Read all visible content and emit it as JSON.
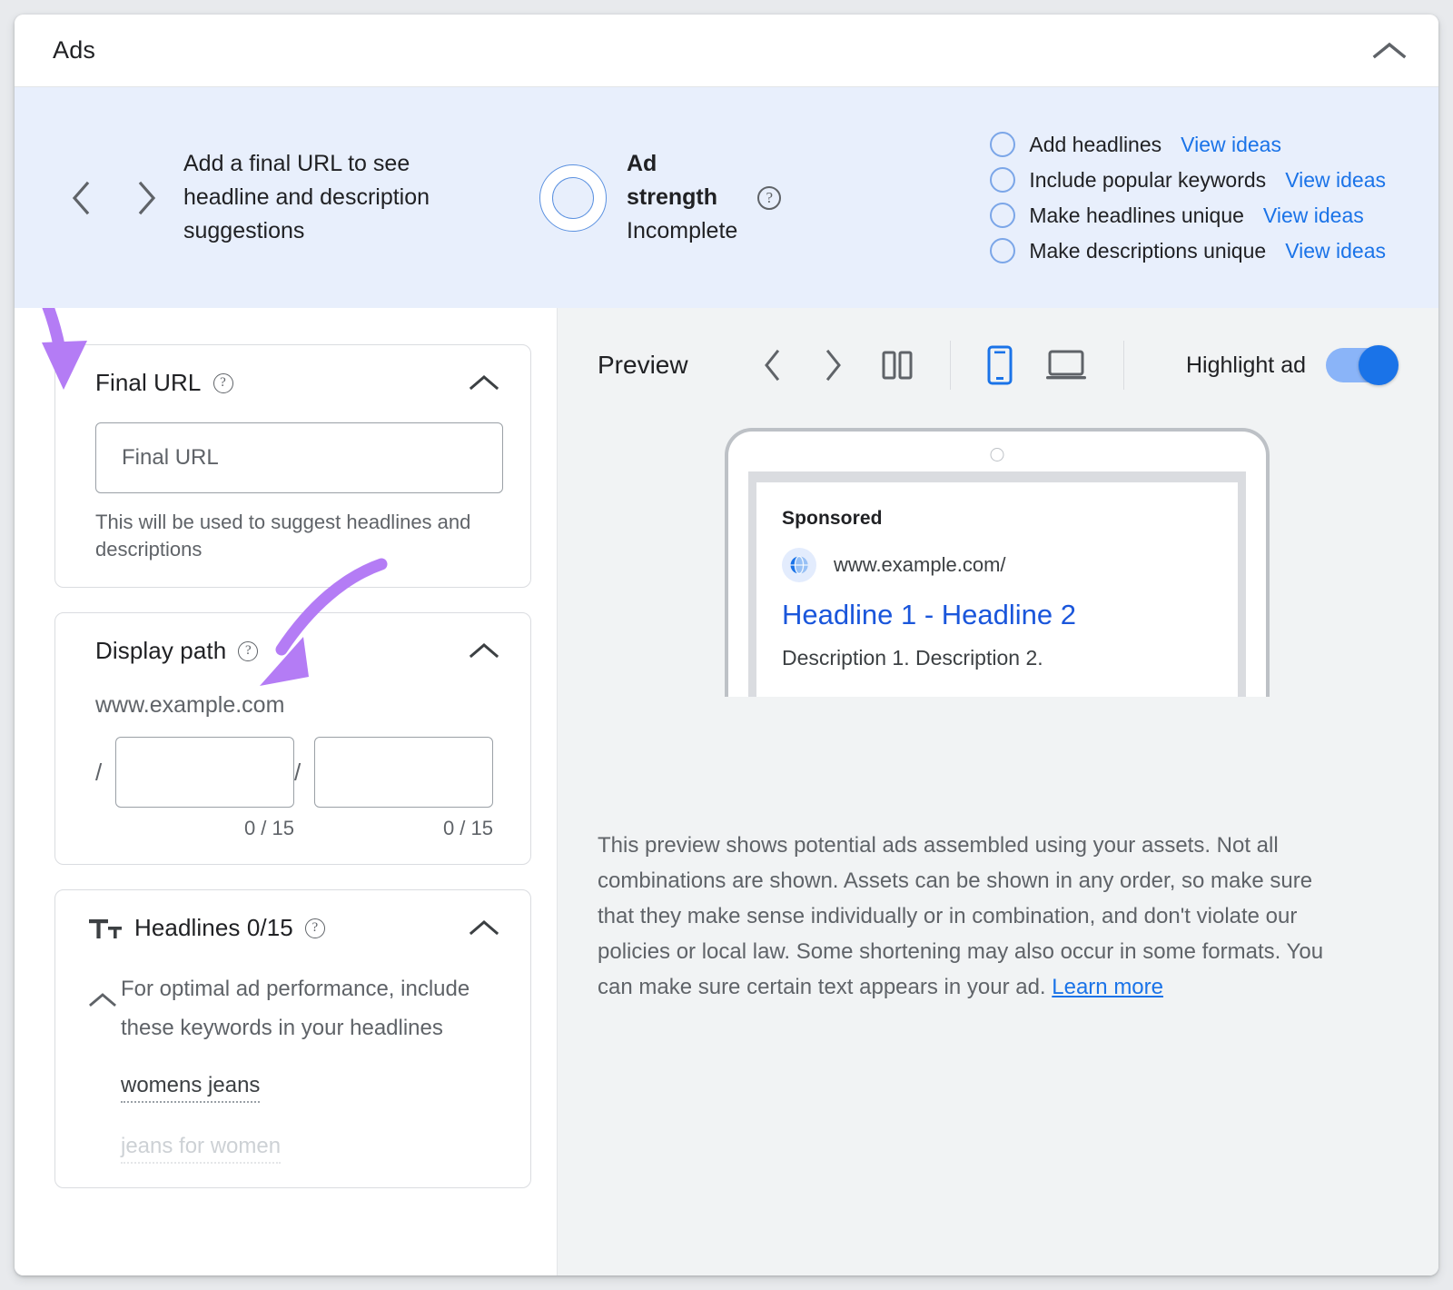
{
  "header": {
    "title": "Ads",
    "collapse_icon": "chevron-up-icon"
  },
  "strength_banner": {
    "prev_icon": "chevron-left-icon",
    "next_icon": "chevron-right-icon",
    "suggestion_text": "Add a final URL to see headline and description suggestions",
    "ad_strength_label_line1": "Ad",
    "ad_strength_label_line2": "strength",
    "ad_strength_value": "Incomplete",
    "help_icon": "help-circle-icon",
    "checklist": [
      {
        "label": "Add headlines",
        "action": "View ideas"
      },
      {
        "label": "Include popular keywords",
        "action": "View ideas"
      },
      {
        "label": "Make headlines unique",
        "action": "View ideas"
      },
      {
        "label": "Make descriptions unique",
        "action": "View ideas"
      }
    ]
  },
  "final_url_card": {
    "title": "Final URL",
    "help_icon": "help-circle-icon",
    "collapse_icon": "chevron-up-icon",
    "input_placeholder": "Final URL",
    "input_value": "",
    "hint": "This will be used to suggest headlines and descriptions"
  },
  "display_path_card": {
    "title": "Display path",
    "help_icon": "help-circle-icon",
    "collapse_icon": "chevron-up-icon",
    "domain": "www.example.com",
    "separator": "/",
    "path1_value": "",
    "path1_counter": "0 / 15",
    "path2_value": "",
    "path2_counter": "0 / 15"
  },
  "headlines_card": {
    "icon": "text-format-icon",
    "title": "Headlines 0/15",
    "help_icon": "help-circle-icon",
    "collapse_icon": "chevron-up-icon",
    "expand_icon": "chevron-up-icon",
    "keyword_hint": "For optimal ad performance, include these keywords in your headlines",
    "keywords": [
      "womens jeans",
      "jeans for women"
    ]
  },
  "preview": {
    "title": "Preview",
    "prev_icon": "chevron-left-icon",
    "next_icon": "chevron-right-icon",
    "split_view_icon": "split-view-icon",
    "mobile_icon": "mobile-device-icon",
    "desktop_icon": "desktop-device-icon",
    "highlight_label": "Highlight ad",
    "highlight_on": true,
    "active_device": "mobile",
    "ad": {
      "sponsored_label": "Sponsored",
      "favicon_icon": "globe-icon",
      "url": "www.example.com/",
      "headline": "Headline 1 - Headline 2",
      "description": "Description 1. Description 2."
    },
    "disclaimer_text": "This preview shows potential ads assembled using your assets. Not all combinations are shown. Assets can be shown in any order, so make sure that they make sense individually or in combination, and don't violate our policies or local law. Some shortening may also occur in some formats. You can make sure certain text appears in your ad. ",
    "disclaimer_link": "Learn more"
  },
  "colors": {
    "banner_bg": "#e8effc",
    "link_blue": "#1a73e8",
    "toggle_on": "#1a73e8",
    "annotation_purple": "#b47cf5",
    "right_pane_bg": "#f1f3f4"
  }
}
